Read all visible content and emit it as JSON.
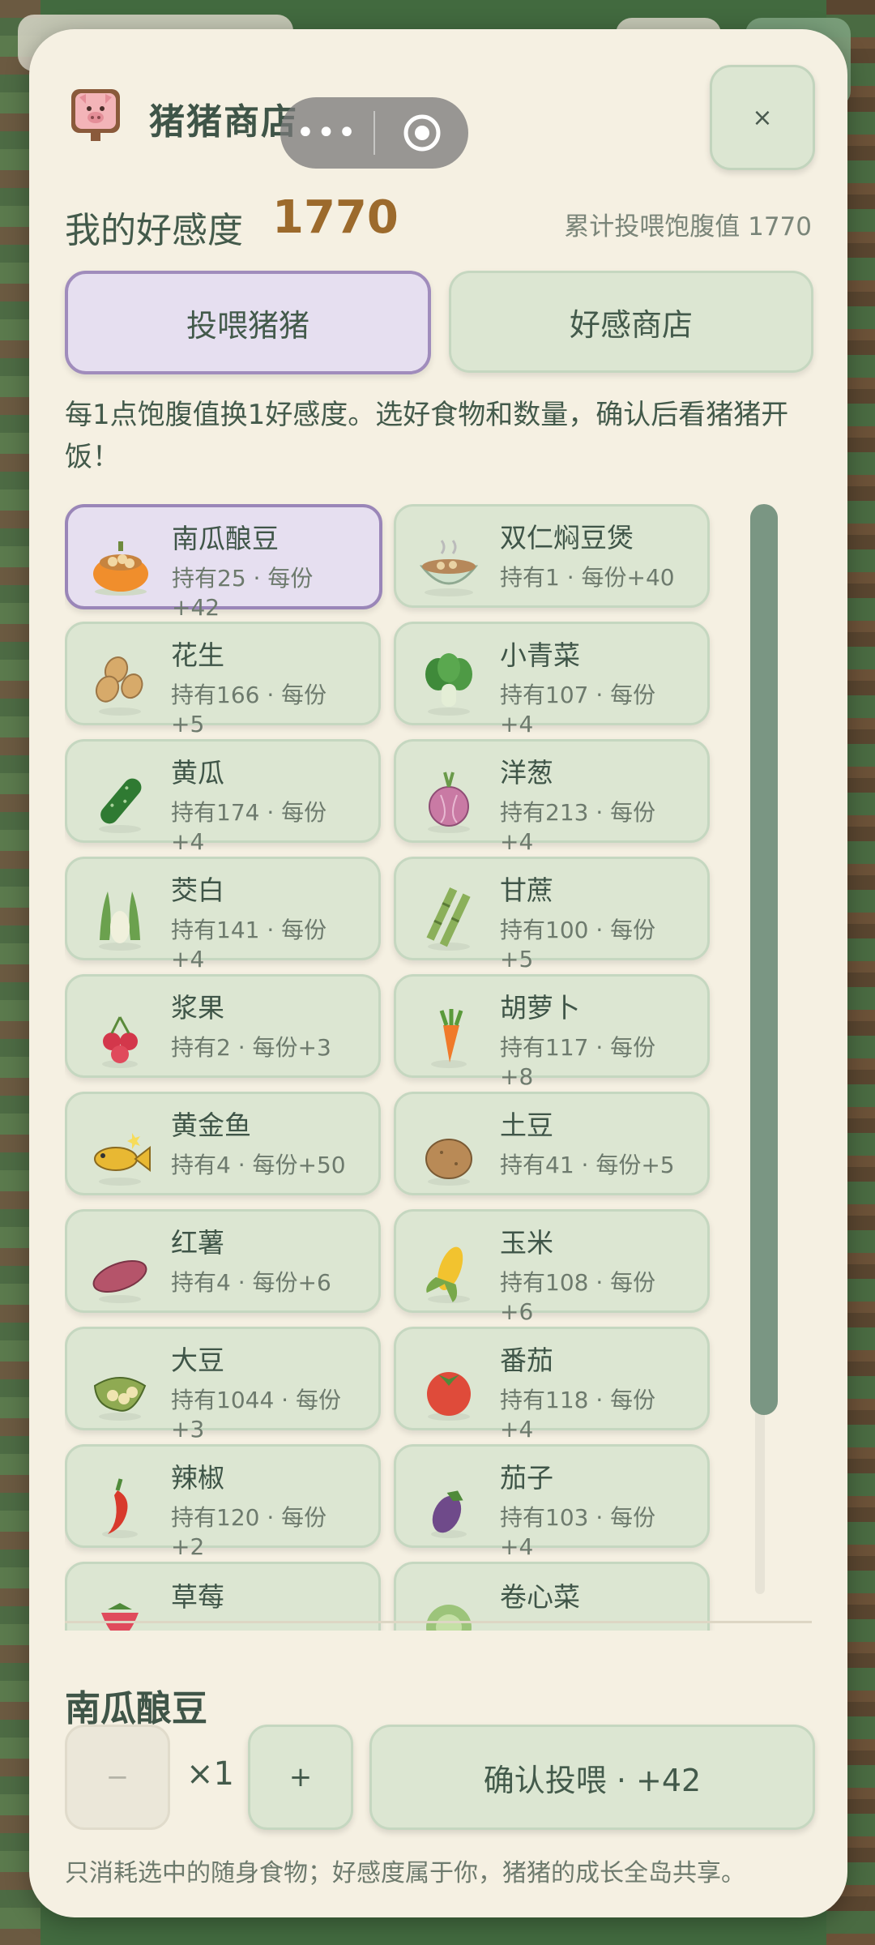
{
  "app": {
    "title": "猪猪商店",
    "close_label": "×"
  },
  "mini_program_capsule": {
    "menu_label": "•••"
  },
  "favorability": {
    "label": "我的好感度",
    "value": "1770",
    "total_text": "累计投喂饱腹值 1770"
  },
  "tabs": [
    {
      "label": "投喂猪猪",
      "active": true
    },
    {
      "label": "好感商店",
      "active": false
    }
  ],
  "description": "每1点饱腹值换1好感度。选好食物和数量，确认后看猪猪开饭！",
  "items": [
    {
      "name": "南瓜酿豆",
      "meta": "持有25 · 每份+42",
      "icon": "pumpkin-beans-icon",
      "selected": true
    },
    {
      "name": "双仁焖豆煲",
      "meta": "持有1 · 每份+40",
      "icon": "bean-stew-bowl-icon"
    },
    {
      "name": "花生",
      "meta": "持有166 · 每份+5",
      "icon": "peanut-icon"
    },
    {
      "name": "小青菜",
      "meta": "持有107 · 每份+4",
      "icon": "bok-choy-icon"
    },
    {
      "name": "黄瓜",
      "meta": "持有174 · 每份+4",
      "icon": "cucumber-icon"
    },
    {
      "name": "洋葱",
      "meta": "持有213 · 每份+4",
      "icon": "onion-icon"
    },
    {
      "name": "茭白",
      "meta": "持有141 · 每份+4",
      "icon": "water-bamboo-icon"
    },
    {
      "name": "甘蔗",
      "meta": "持有100 · 每份+5",
      "icon": "sugarcane-icon"
    },
    {
      "name": "浆果",
      "meta": "持有2 · 每份+3",
      "icon": "berries-icon"
    },
    {
      "name": "胡萝卜",
      "meta": "持有117 · 每份+8",
      "icon": "carrot-icon"
    },
    {
      "name": "黄金鱼",
      "meta": "持有4 · 每份+50",
      "icon": "golden-fish-icon"
    },
    {
      "name": "土豆",
      "meta": "持有41 · 每份+5",
      "icon": "potato-icon"
    },
    {
      "name": "红薯",
      "meta": "持有4 · 每份+6",
      "icon": "sweet-potato-icon"
    },
    {
      "name": "玉米",
      "meta": "持有108 · 每份+6",
      "icon": "corn-icon"
    },
    {
      "name": "大豆",
      "meta": "持有1044 · 每份+3",
      "icon": "soybean-icon"
    },
    {
      "name": "番茄",
      "meta": "持有118 · 每份+4",
      "icon": "tomato-icon"
    },
    {
      "name": "辣椒",
      "meta": "持有120 · 每份+2",
      "icon": "chili-icon"
    },
    {
      "name": "茄子",
      "meta": "持有103 · 每份+4",
      "icon": "eggplant-icon"
    },
    {
      "name": "草莓",
      "meta": "",
      "icon": "strawberry-icon"
    },
    {
      "name": "卷心菜",
      "meta": "",
      "icon": "cabbage-icon"
    }
  ],
  "selection": {
    "name": "南瓜酿豆",
    "minus_label": "−",
    "quantity": "×1",
    "plus_label": "+",
    "confirm_label": "确认投喂 · +42"
  },
  "footnote": "只消耗选中的随身食物；好感度属于你，猪猪的成长全岛共享。"
}
